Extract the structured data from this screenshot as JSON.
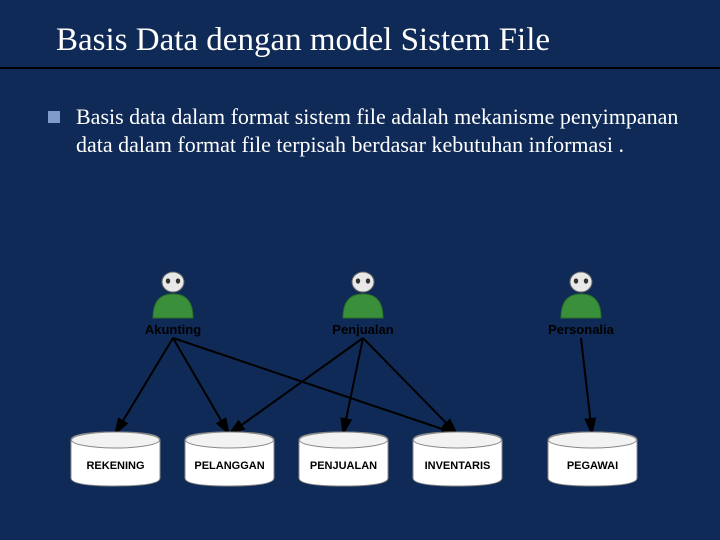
{
  "title": "Basis Data dengan model Sistem File",
  "bullet": "Basis data dalam format sistem file adalah mekanisme penyimpanan data dalam format file terpisah berdasar kebutuhan informasi .",
  "users": [
    {
      "label": "Akunting"
    },
    {
      "label": "Penjualan"
    },
    {
      "label": "Personalia"
    }
  ],
  "files": [
    {
      "label": "REKENING"
    },
    {
      "label": "PELANGGAN"
    },
    {
      "label": "PENJUALAN"
    },
    {
      "label": "INVENTARIS"
    },
    {
      "label": "PEGAWAI"
    }
  ],
  "links": [
    {
      "from_user": 0,
      "to_file": 0
    },
    {
      "from_user": 0,
      "to_file": 1
    },
    {
      "from_user": 0,
      "to_file": 3
    },
    {
      "from_user": 1,
      "to_file": 1
    },
    {
      "from_user": 1,
      "to_file": 2
    },
    {
      "from_user": 1,
      "to_file": 3
    },
    {
      "from_user": 2,
      "to_file": 4
    }
  ]
}
